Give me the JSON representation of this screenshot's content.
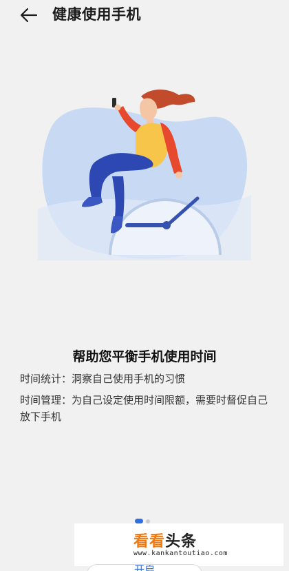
{
  "header": {
    "back_icon": "back-arrow-icon",
    "title": "健康使用手机"
  },
  "illustration": {
    "icon": "woman-sitting-on-clock-illustration",
    "colors": {
      "blob": "#c8daf3",
      "clock_face": "#eef3fb",
      "clock_rim": "#b8cbe7",
      "hands": "#3552b0",
      "shirt": "#f7c54a",
      "sleeve": "#e6492d",
      "pants": "#2d48b3",
      "hair": "#c24b2c"
    }
  },
  "content": {
    "headline": "帮助您平衡手机使用时间",
    "desc1": "时间统计：洞察自己使用手机的习惯",
    "desc2": "时间管理：为自己设定使用时间限额，需要时督促自己放下手机"
  },
  "pager": {
    "page": 1,
    "total": 2,
    "active_color": "#2f6fe0"
  },
  "watermark": {
    "brand_part1": "看看",
    "brand_part2": "头条",
    "url": "www.kankantoutiao.com"
  },
  "footer": {
    "start_label": "开启"
  }
}
